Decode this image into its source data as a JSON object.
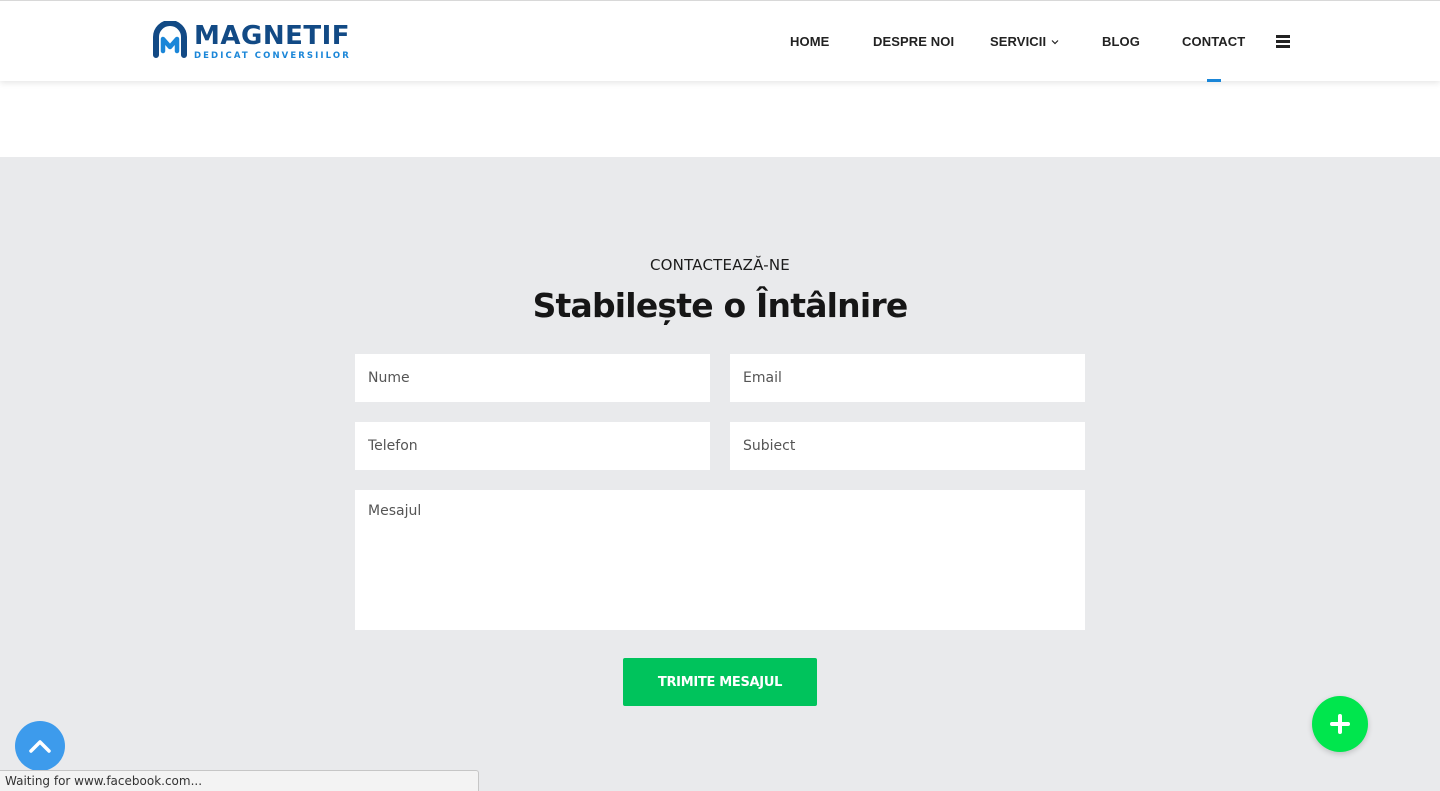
{
  "header": {
    "logo": {
      "name": "MAGNETIF",
      "tagline": "DEDICAT CONVERSIILOR"
    },
    "nav": [
      {
        "label": "HOME"
      },
      {
        "label": "DESPRE NOI"
      },
      {
        "label": "SERVICII",
        "icon": "chevron-down-icon"
      },
      {
        "label": "BLOG"
      },
      {
        "label": "CONTACT",
        "active": true
      }
    ],
    "menu_icon": "hamburger-icon"
  },
  "contact": {
    "eyebrow": "CONTACTEAZĂ-NE",
    "title": "Stabilește o Întâlnire",
    "fields": {
      "name_placeholder": "Nume",
      "email_placeholder": "Email",
      "phone_placeholder": "Telefon",
      "subject_placeholder": "Subiect",
      "message_placeholder": "Mesajul"
    },
    "submit_label": "TRIMITE MESAJUL"
  },
  "floating": {
    "plus_icon": "plus-icon",
    "scroll_top_icon": "chevron-up-icon"
  },
  "status_bar": {
    "text": "Waiting for www.facebook.com..."
  },
  "colors": {
    "brand_dark": "#124a85",
    "brand_accent": "#1a86d8",
    "submit_green": "#00c35c",
    "fab_green": "#00e64d",
    "scroll_blue": "#3d9bec",
    "section_bg": "#e9eaec"
  }
}
